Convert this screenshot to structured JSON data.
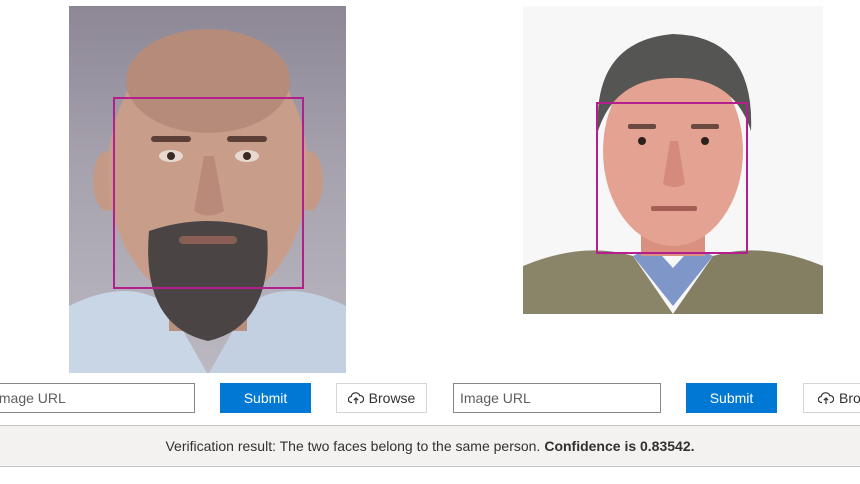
{
  "left_panel": {
    "photo_icon": "face-photo-icon",
    "url_placeholder": "Image URL",
    "submit_label": "Submit",
    "browse_label": "Browse",
    "browse_icon": "cloud-upload-icon"
  },
  "right_panel": {
    "photo_icon": "face-photo-icon",
    "url_placeholder": "Image URL",
    "submit_label": "Submit",
    "browse_label": "Browse",
    "browse_icon": "cloud-upload-icon"
  },
  "result": {
    "text": "Verification result: The two faces belong to the same person.",
    "confidence_text": "Confidence is 0.83542."
  },
  "colors": {
    "accent": "#0078d4",
    "face_box": "#b3208e",
    "result_bar": "#f3f2f1"
  }
}
